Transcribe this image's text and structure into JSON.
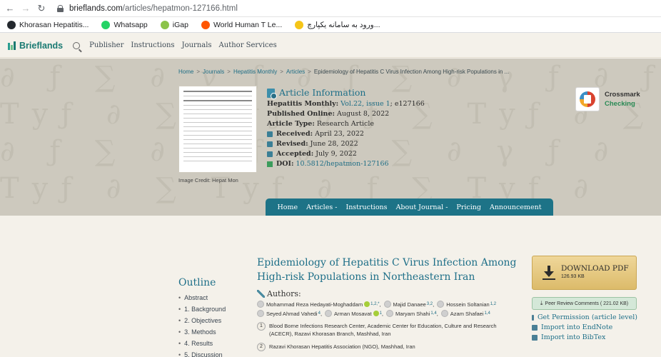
{
  "browser": {
    "url_host": "brieflands.com",
    "url_path": "/articles/hepatmon-127166.html",
    "bookmarks": [
      {
        "label": "Khorasan Hepatitis...",
        "icon": "github-icon",
        "color": "#24292e"
      },
      {
        "label": "Whatsapp",
        "icon": "whatsapp-icon",
        "color": "#25d366"
      },
      {
        "label": "iGap",
        "icon": "igap-icon",
        "color": "#8bc34a"
      },
      {
        "label": "World Human T Le...",
        "icon": "soundcloud-icon",
        "color": "#ff5500"
      },
      {
        "label": "ورود به سامانه یکپارچ...",
        "icon": "m-logo-icon",
        "color": "#f5c518"
      }
    ]
  },
  "site": {
    "logo": "Brieflands",
    "nav": [
      "Publisher",
      "Instructions",
      "Journals",
      "Author Services"
    ]
  },
  "breadcrumb": [
    "Home",
    "Journals",
    "Hepatitis Monthly",
    "Articles",
    "Epidemiology of Hepatitis C Virus Infection Among High-risk Populations in ..."
  ],
  "thumbnail_caption": "Image Credit: Hepat Mon",
  "article_info": {
    "heading": "Article Information",
    "journal_label": "Hepatitis Monthly:",
    "journal_link": "Vol.22, issue 1",
    "journal_suffix": "; e127166",
    "published_label": "Published Online:",
    "published": "August 8, 2022",
    "type_label": "Article Type:",
    "type": "Research Article",
    "received_label": "Received:",
    "received": "April 23, 2022",
    "revised_label": "Revised:",
    "revised": "June 28, 2022",
    "accepted_label": "Accepted:",
    "accepted": "July 9, 2022",
    "doi_label": "DOI:",
    "doi": "10.5812/hepatmon-127166"
  },
  "crossmark": {
    "title": "Crossmark",
    "status": "Checking"
  },
  "journal_nav": [
    "Home",
    "Articles -",
    "Instructions",
    "About Journal -",
    "Pricing",
    "Announcement"
  ],
  "outline": {
    "title": "Outline",
    "items": [
      "Abstract",
      "1. Background",
      "2. Objectives",
      "3. Methods",
      "4. Results",
      "5. Discussion"
    ]
  },
  "article": {
    "title": "Epidemiology of Hepatitis C Virus Infection Among High-risk Populations in Northeastern Iran",
    "authors_heading": "Authors:",
    "authors_row1": [
      {
        "name": "Mohammad Reza Hedayati-Moghaddam",
        "sup": "1,2,*",
        "orcid": true
      },
      {
        "name": "Majid Danaee",
        "sup": "3,2",
        "orcid": false
      },
      {
        "name": "Hossein Soltanian",
        "sup": "1,2",
        "orcid": false
      }
    ],
    "authors_row2": [
      {
        "name": "Seyed Ahmad Vahedi",
        "sup": "4",
        "orcid": false
      },
      {
        "name": "Arman Mosavat",
        "sup": "1",
        "orcid": true
      },
      {
        "name": "Maryam Shahi",
        "sup": "1,4",
        "orcid": false
      },
      {
        "name": "Azam Shafaei",
        "sup": "1,4",
        "orcid": false
      }
    ],
    "affiliations": [
      {
        "num": "1",
        "text": "Blood Borne Infections Research Center, Academic Center for Education, Culture and Research (ACECR), Razavi Khorasan Branch, Mashhad, Iran"
      },
      {
        "num": "2",
        "text": "Razavi Khorasan Hepatitis Association (NGO), Mashhad, Iran"
      }
    ]
  },
  "downloads": {
    "pdf_label": "DOWNLOAD PDF",
    "pdf_size": "126.93 KB",
    "peer_review": "Peer Review Comments ( 221.02 KB)",
    "links": [
      "Get Permission (article level)",
      "Import into EndNote",
      "Import into BibTex"
    ]
  }
}
